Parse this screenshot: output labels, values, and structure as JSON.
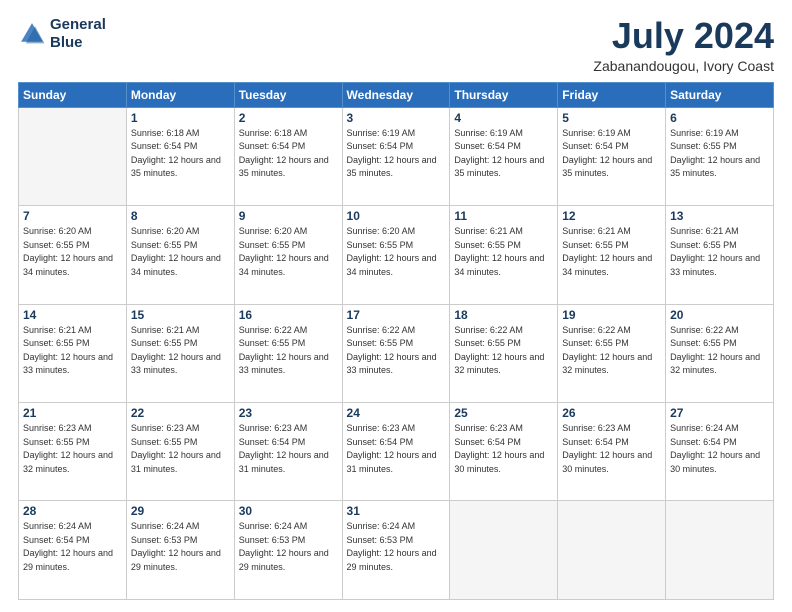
{
  "header": {
    "logo_line1": "General",
    "logo_line2": "Blue",
    "title": "July 2024",
    "subtitle": "Zabanandougou, Ivory Coast"
  },
  "days_of_week": [
    "Sunday",
    "Monday",
    "Tuesday",
    "Wednesday",
    "Thursday",
    "Friday",
    "Saturday"
  ],
  "weeks": [
    [
      {
        "day": "",
        "info": ""
      },
      {
        "day": "1",
        "info": "Sunrise: 6:18 AM\nSunset: 6:54 PM\nDaylight: 12 hours\nand 35 minutes."
      },
      {
        "day": "2",
        "info": "Sunrise: 6:18 AM\nSunset: 6:54 PM\nDaylight: 12 hours\nand 35 minutes."
      },
      {
        "day": "3",
        "info": "Sunrise: 6:19 AM\nSunset: 6:54 PM\nDaylight: 12 hours\nand 35 minutes."
      },
      {
        "day": "4",
        "info": "Sunrise: 6:19 AM\nSunset: 6:54 PM\nDaylight: 12 hours\nand 35 minutes."
      },
      {
        "day": "5",
        "info": "Sunrise: 6:19 AM\nSunset: 6:54 PM\nDaylight: 12 hours\nand 35 minutes."
      },
      {
        "day": "6",
        "info": "Sunrise: 6:19 AM\nSunset: 6:55 PM\nDaylight: 12 hours\nand 35 minutes."
      }
    ],
    [
      {
        "day": "7",
        "info": ""
      },
      {
        "day": "8",
        "info": "Sunrise: 6:20 AM\nSunset: 6:55 PM\nDaylight: 12 hours\nand 34 minutes."
      },
      {
        "day": "9",
        "info": "Sunrise: 6:20 AM\nSunset: 6:55 PM\nDaylight: 12 hours\nand 34 minutes."
      },
      {
        "day": "10",
        "info": "Sunrise: 6:20 AM\nSunset: 6:55 PM\nDaylight: 12 hours\nand 34 minutes."
      },
      {
        "day": "11",
        "info": "Sunrise: 6:21 AM\nSunset: 6:55 PM\nDaylight: 12 hours\nand 34 minutes."
      },
      {
        "day": "12",
        "info": "Sunrise: 6:21 AM\nSunset: 6:55 PM\nDaylight: 12 hours\nand 34 minutes."
      },
      {
        "day": "13",
        "info": "Sunrise: 6:21 AM\nSunset: 6:55 PM\nDaylight: 12 hours\nand 33 minutes."
      }
    ],
    [
      {
        "day": "14",
        "info": ""
      },
      {
        "day": "15",
        "info": "Sunrise: 6:21 AM\nSunset: 6:55 PM\nDaylight: 12 hours\nand 33 minutes."
      },
      {
        "day": "16",
        "info": "Sunrise: 6:22 AM\nSunset: 6:55 PM\nDaylight: 12 hours\nand 33 minutes."
      },
      {
        "day": "17",
        "info": "Sunrise: 6:22 AM\nSunset: 6:55 PM\nDaylight: 12 hours\nand 33 minutes."
      },
      {
        "day": "18",
        "info": "Sunrise: 6:22 AM\nSunset: 6:55 PM\nDaylight: 12 hours\nand 32 minutes."
      },
      {
        "day": "19",
        "info": "Sunrise: 6:22 AM\nSunset: 6:55 PM\nDaylight: 12 hours\nand 32 minutes."
      },
      {
        "day": "20",
        "info": "Sunrise: 6:22 AM\nSunset: 6:55 PM\nDaylight: 12 hours\nand 32 minutes."
      }
    ],
    [
      {
        "day": "21",
        "info": ""
      },
      {
        "day": "22",
        "info": "Sunrise: 6:23 AM\nSunset: 6:55 PM\nDaylight: 12 hours\nand 31 minutes."
      },
      {
        "day": "23",
        "info": "Sunrise: 6:23 AM\nSunset: 6:54 PM\nDaylight: 12 hours\nand 31 minutes."
      },
      {
        "day": "24",
        "info": "Sunrise: 6:23 AM\nSunset: 6:54 PM\nDaylight: 12 hours\nand 31 minutes."
      },
      {
        "day": "25",
        "info": "Sunrise: 6:23 AM\nSunset: 6:54 PM\nDaylight: 12 hours\nand 30 minutes."
      },
      {
        "day": "26",
        "info": "Sunrise: 6:23 AM\nSunset: 6:54 PM\nDaylight: 12 hours\nand 30 minutes."
      },
      {
        "day": "27",
        "info": "Sunrise: 6:24 AM\nSunset: 6:54 PM\nDaylight: 12 hours\nand 30 minutes."
      }
    ],
    [
      {
        "day": "28",
        "info": "Sunrise: 6:24 AM\nSunset: 6:54 PM\nDaylight: 12 hours\nand 29 minutes."
      },
      {
        "day": "29",
        "info": "Sunrise: 6:24 AM\nSunset: 6:53 PM\nDaylight: 12 hours\nand 29 minutes."
      },
      {
        "day": "30",
        "info": "Sunrise: 6:24 AM\nSunset: 6:53 PM\nDaylight: 12 hours\nand 29 minutes."
      },
      {
        "day": "31",
        "info": "Sunrise: 6:24 AM\nSunset: 6:53 PM\nDaylight: 12 hours\nand 29 minutes."
      },
      {
        "day": "",
        "info": ""
      },
      {
        "day": "",
        "info": ""
      },
      {
        "day": "",
        "info": ""
      }
    ]
  ],
  "week7_sun_info": "Sunrise: 6:20 AM\nSunset: 6:55 PM\nDaylight: 12 hours\nand 34 minutes.",
  "week14_sun_info": "Sunrise: 6:21 AM\nSunset: 6:55 PM\nDaylight: 12 hours\nand 33 minutes.",
  "week21_sun_info": "Sunrise: 6:23 AM\nSunset: 6:55 PM\nDaylight: 12 hours\nand 32 minutes."
}
